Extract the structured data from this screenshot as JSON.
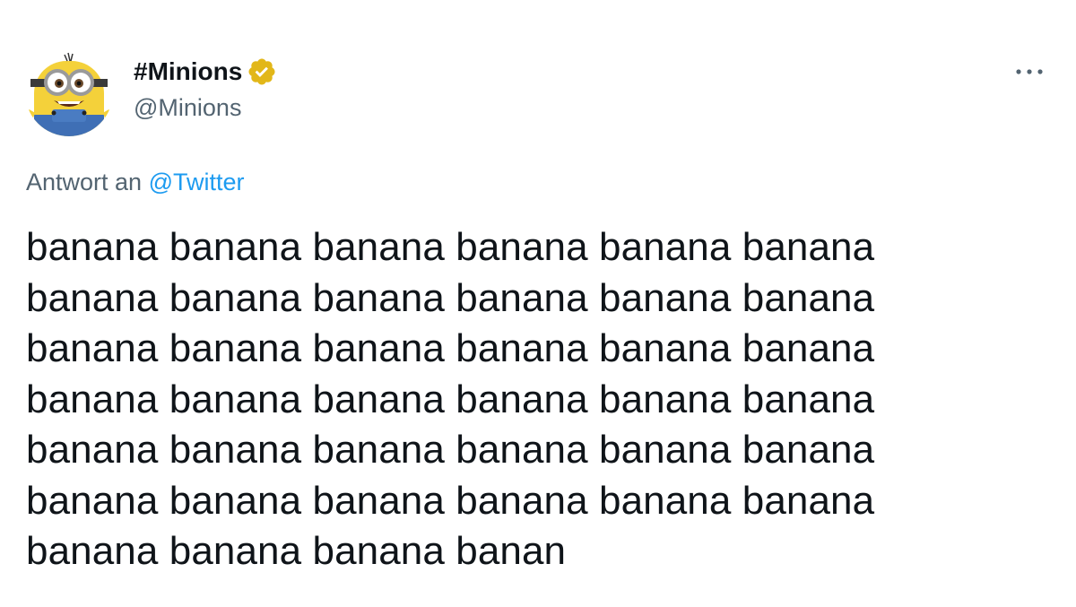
{
  "tweet": {
    "author": {
      "display_name": "#Minions",
      "handle": "@Minions",
      "verified": true,
      "verified_badge_color": "#e2b719",
      "avatar": "minion-avatar"
    },
    "more_options_icon": "more-horizontal-icon",
    "reply_prefix": "Antwort an",
    "reply_mention": "@Twitter",
    "text": "banana banana banana banana banana banana\nbanana banana banana banana banana banana\nbanana banana banana banana banana banana\nbanana banana banana banana banana banana\nbanana banana banana banana banana banana\nbanana banana banana banana banana banana\nbanana banana banana banan"
  },
  "colors": {
    "text_primary": "#0f1419",
    "text_secondary": "#536471",
    "link": "#1d9bf0",
    "background": "#ffffff"
  }
}
